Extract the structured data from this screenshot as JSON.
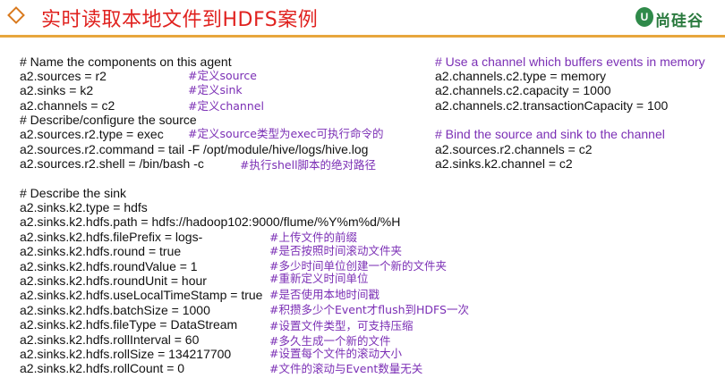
{
  "header": {
    "title": "实时读取本地文件到HDFS案例",
    "logo_mark": "U",
    "logo_text": "尚硅谷"
  },
  "code": {
    "left": [
      "# Name the components on this agent",
      "a2.sources = r2",
      "a2.sinks = k2",
      "a2.channels = c2",
      "# Describe/configure the source",
      "a2.sources.r2.type = exec",
      "a2.sources.r2.command = tail -F /opt/module/hive/logs/hive.log",
      "a2.sources.r2.shell = /bin/bash -c",
      "# Describe the sink",
      "a2.sinks.k2.type = hdfs",
      "a2.sinks.k2.hdfs.path = hdfs://hadoop102:9000/flume/%Y%m%d/%H",
      "a2.sinks.k2.hdfs.filePrefix = logs-",
      "a2.sinks.k2.hdfs.round = true",
      "a2.sinks.k2.hdfs.roundValue = 1",
      "a2.sinks.k2.hdfs.roundUnit = hour",
      "a2.sinks.k2.hdfs.useLocalTimeStamp = true",
      "a2.sinks.k2.hdfs.batchSize = 1000",
      "a2.sinks.k2.hdfs.fileType = DataStream",
      "a2.sinks.k2.hdfs.rollInterval = 60",
      "a2.sinks.k2.hdfs.rollSize = 134217700",
      "a2.sinks.k2.hdfs.rollCount = 0"
    ],
    "comments": [
      "#定义source",
      "#定义sink",
      "#定义channel",
      "#定义source类型为exec可执行命令的",
      "#执行shell脚本的绝对路径",
      "#上传文件的前缀",
      "#是否按照时间滚动文件夹",
      "#多少时间单位创建一个新的文件夹",
      "#重新定义时间单位",
      "#是否使用本地时间戳",
      "#积攒多少个Event才flush到HDFS一次",
      "#设置文件类型，可支持压缩",
      "#多久生成一个新的文件",
      "#设置每个文件的滚动大小",
      "#文件的滚动与Event数量无关"
    ],
    "right": [
      "# Use a channel which buffers events in memory",
      "a2.channels.c2.type = memory",
      "a2.channels.c2.capacity = 1000",
      "a2.channels.c2.transactionCapacity = 100",
      "# Bind the source and sink to the channel",
      "a2.sources.r2.channels = c2",
      "a2.sinks.k2.channel = c2"
    ]
  },
  "colors": {
    "title": "#e0221f",
    "accent_line": "#e7a63d",
    "comment": "#7b2fb5",
    "logo": "#2f8a4a"
  }
}
